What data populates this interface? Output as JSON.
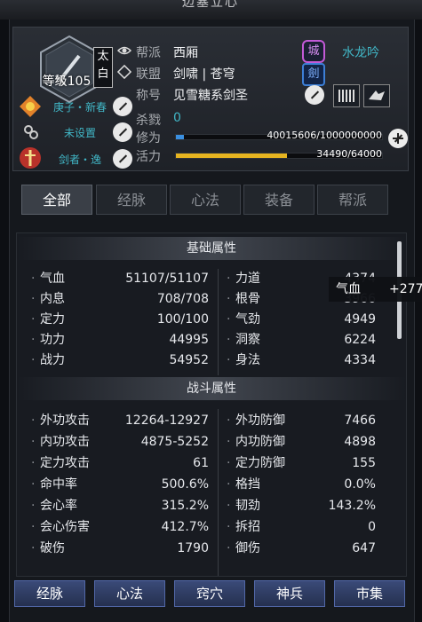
{
  "window": {
    "title": "边塞立心"
  },
  "profile": {
    "level": "等级105",
    "rank_badge": "太白",
    "faction_label": "帮派",
    "faction_value": "西厢",
    "alliance_label": "联盟",
    "alliance_value": "剑啸 | 苍穹",
    "title_label": "称号",
    "title_value": "见雪糖系剑圣",
    "kill_label": "杀戮",
    "kill_value": "0",
    "cultivation_label": "修为",
    "cultivation_value": "40015606/1000000000",
    "cultivation_fraction": 0.04,
    "vitality_label": "活力",
    "vitality_value": "34490/64000",
    "vitality_fraction": 0.539,
    "tag1": "庚子・新春",
    "tag2": "未设置",
    "tag3": "剑者・逸",
    "server": "水龙吟",
    "emblem1": "城",
    "emblem2": "劍"
  },
  "tabs": [
    {
      "label": "全部",
      "active": true
    },
    {
      "label": "经脉",
      "active": false
    },
    {
      "label": "心法",
      "active": false
    },
    {
      "label": "装备",
      "active": false
    },
    {
      "label": "帮派",
      "active": false
    }
  ],
  "basic": {
    "title": "基础属性",
    "left": [
      {
        "name": "气血",
        "value": "51107/51107"
      },
      {
        "name": "内息",
        "value": "708/708"
      },
      {
        "name": "定力",
        "value": "100/100"
      },
      {
        "name": "功力",
        "value": "44995"
      },
      {
        "name": "战力",
        "value": "54952"
      }
    ],
    "right": [
      {
        "name": "力道",
        "value": "4374"
      },
      {
        "name": "根骨",
        "value": "3966"
      },
      {
        "name": "气劲",
        "value": "4949"
      },
      {
        "name": "洞察",
        "value": "6224"
      },
      {
        "name": "身法",
        "value": "4334"
      }
    ]
  },
  "combat": {
    "title": "战斗属性",
    "left": [
      {
        "name": "外功攻击",
        "value": "12264-12927"
      },
      {
        "name": "内功攻击",
        "value": "4875-5252"
      },
      {
        "name": "定力攻击",
        "value": "61"
      },
      {
        "name": "命中率",
        "value": "500.6%"
      },
      {
        "name": "会心率",
        "value": "315.2%"
      },
      {
        "name": "会心伤害",
        "value": "412.7%"
      },
      {
        "name": "破伤",
        "value": "1790"
      }
    ],
    "right": [
      {
        "name": "外功防御",
        "value": "7466"
      },
      {
        "name": "内功防御",
        "value": "4898"
      },
      {
        "name": "定力防御",
        "value": "155"
      },
      {
        "name": "格挡",
        "value": "0.0%"
      },
      {
        "name": "韧劲",
        "value": "143.2%"
      },
      {
        "name": "拆招",
        "value": "0"
      },
      {
        "name": "御伤",
        "value": "647"
      }
    ]
  },
  "tooltip": {
    "name": "气血",
    "value": "+277"
  },
  "bottom_buttons": [
    "经脉",
    "心法",
    "窍穴",
    "神兵",
    "市集"
  ]
}
